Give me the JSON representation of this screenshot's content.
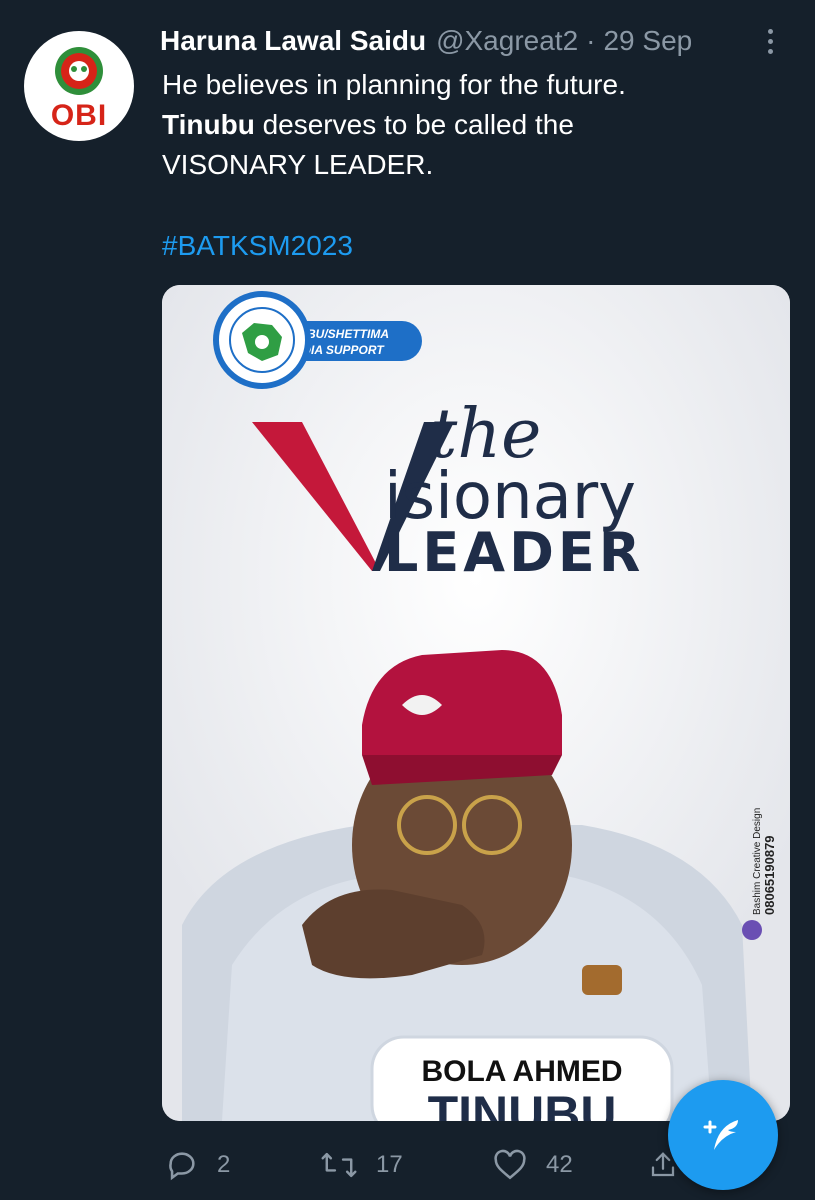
{
  "author": {
    "name": "Haruna Lawal Saidu",
    "handle": "@Xagreat2",
    "date": "29 Sep",
    "avatar_text": "OBI"
  },
  "tweet": {
    "line1": "He believes in planning for the future.",
    "line2_bold": "Tinubu",
    "line2_rest": " deserves to be called the",
    "line3": "VISONARY LEADER.",
    "hashtag": "#BATKSM2023"
  },
  "media": {
    "badge_line1": "TINUBU/SHETTIMA",
    "badge_line2": "MEDIA SUPPORT",
    "poster_the": "the",
    "poster_isionary": "isionary",
    "poster_leader": "LEADER",
    "credit_line1": "Bashim Creative Design",
    "credit_line2": "08065190879",
    "name_line1": "BOLA AHMED",
    "name_line2": "TINUBU"
  },
  "actions": {
    "replies": "2",
    "retweets": "17",
    "likes": "42"
  },
  "colors": {
    "background": "#15202b",
    "accent": "#1d9bf0",
    "muted": "#8b98a5"
  },
  "icons": [
    "avatar-logo",
    "more-icon",
    "reply-icon",
    "retweet-icon",
    "like-icon",
    "share-icon",
    "compose-icon"
  ]
}
